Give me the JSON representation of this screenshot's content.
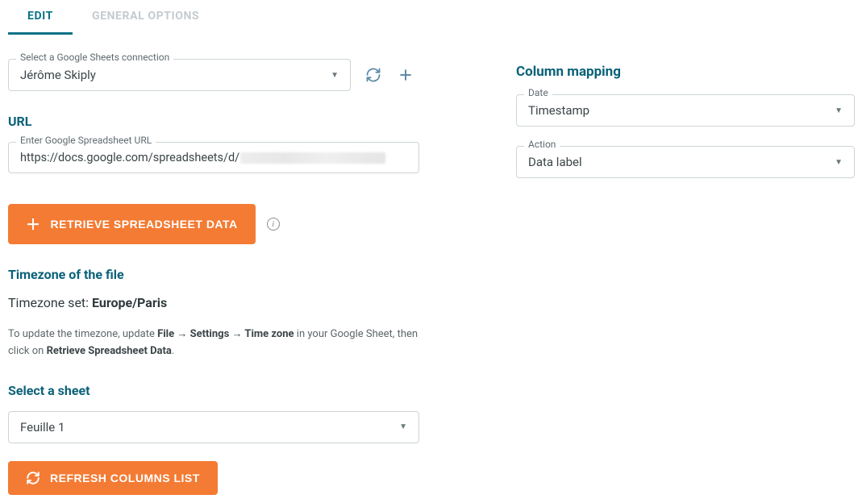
{
  "tabs": {
    "edit": "EDIT",
    "general": "GENERAL OPTIONS"
  },
  "connection": {
    "label": "Select a Google Sheets connection",
    "value": "Jérôme Skiply"
  },
  "url": {
    "heading": "URL",
    "label": "Enter Google Spreadsheet URL",
    "value_prefix": "https://docs.google.com/spreadsheets/d/"
  },
  "buttons": {
    "retrieve": "RETRIEVE SPREADSHEET DATA",
    "refresh": "REFRESH COLUMNS LIST"
  },
  "timezone": {
    "heading": "Timezone of the file",
    "set_prefix": "Timezone set: ",
    "set_value": "Europe/Paris",
    "help_pre": "To update the timezone, update ",
    "help_bold1": "File → Settings → Time zone",
    "help_mid": " in your Google Sheet, then click on ",
    "help_bold2": "Retrieve Spreadsheet Data",
    "help_end": "."
  },
  "sheet": {
    "heading": "Select a sheet",
    "value": "Feuille 1"
  },
  "mapping": {
    "heading": "Column mapping",
    "date_label": "Date",
    "date_value": "Timestamp",
    "action_label": "Action",
    "action_value": "Data label"
  }
}
